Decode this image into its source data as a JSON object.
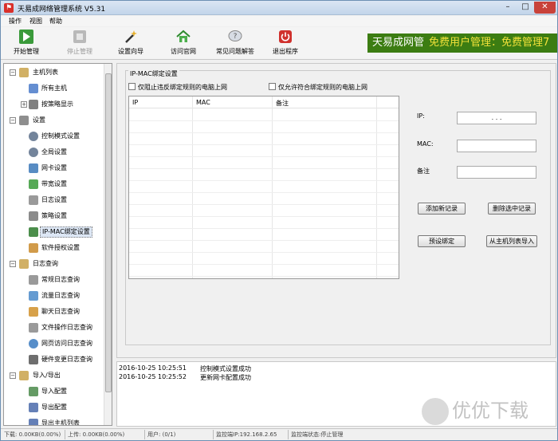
{
  "window": {
    "title": "天易成网络管理系统 V5.31",
    "minimize": "–",
    "maximize": "□",
    "close": "✕"
  },
  "menu": [
    "操作",
    "视图",
    "帮助"
  ],
  "toolbar": [
    {
      "label": "开始管理",
      "icon": "play-icon",
      "enabled": true
    },
    {
      "label": "停止管理",
      "icon": "stop-icon",
      "enabled": false
    },
    {
      "label": "设置向导",
      "icon": "wand-icon",
      "enabled": true
    },
    {
      "label": "访问官网",
      "icon": "home-icon",
      "enabled": true
    },
    {
      "label": "常见问题解答",
      "icon": "faq-icon",
      "enabled": true
    },
    {
      "label": "退出程序",
      "icon": "power-icon",
      "enabled": true
    }
  ],
  "banner": {
    "text": "天易成网管",
    "highlight": "免费用户管理：免费管理7"
  },
  "tree": [
    {
      "label": "主机列表",
      "expander": "−",
      "level": 0
    },
    {
      "label": "所有主机",
      "level": 1
    },
    {
      "label": "按策略显示",
      "expander": "+",
      "level": 1
    },
    {
      "label": "设置",
      "expander": "−",
      "level": 0
    },
    {
      "label": "控制模式设置",
      "level": 1
    },
    {
      "label": "全局设置",
      "level": 1
    },
    {
      "label": "网卡设置",
      "level": 1
    },
    {
      "label": "带宽设置",
      "level": 1
    },
    {
      "label": "日志设置",
      "level": 1
    },
    {
      "label": "策略设置",
      "level": 1
    },
    {
      "label": "IP-MAC绑定设置",
      "level": 1,
      "selected": true
    },
    {
      "label": "软件授权设置",
      "level": 1
    },
    {
      "label": "日志查询",
      "expander": "−",
      "level": 0
    },
    {
      "label": "常规日志查询",
      "level": 1
    },
    {
      "label": "流量日志查询",
      "level": 1
    },
    {
      "label": "聊天日志查询",
      "level": 1
    },
    {
      "label": "文件操作日志查询",
      "level": 1
    },
    {
      "label": "网页访问日志查询",
      "level": 1
    },
    {
      "label": "硬件变更日志查询",
      "level": 1
    },
    {
      "label": "导入/导出",
      "expander": "−",
      "level": 0
    },
    {
      "label": "导入配置",
      "level": 1
    },
    {
      "label": "导出配置",
      "level": 1
    },
    {
      "label": "导出主机列表",
      "level": 1
    }
  ],
  "panel": {
    "group_title": "IP-MAC绑定设置",
    "check1": "仅阻止违反绑定规则的电脑上网",
    "check2": "仅允许符合绑定规则的电脑上网",
    "columns": [
      "IP",
      "MAC",
      "备注"
    ],
    "ip_label": "IP:",
    "ip_value": ".      .      .",
    "mac_label": "MAC:",
    "mac_value": "",
    "note_label": "备注",
    "note_value": "",
    "btn_add": "添加新记录",
    "btn_delete": "删除选中记录",
    "btn_preset": "预设绑定",
    "btn_import": "从主机列表导入"
  },
  "log": [
    {
      "time": "2016-10-25 10:25:51",
      "msg": "控制模式设置成功"
    },
    {
      "time": "2016-10-25 10:25:52",
      "msg": "更新网卡配置成功"
    }
  ],
  "status": {
    "download": "下载: 0.00KB(0.00%)",
    "upload": "上传: 0.00KB(0.00%)",
    "users": "用户: (0/1)",
    "monitor_ip": "监控端IP:192.168.2.65",
    "monitor_state": "监控端状态:停止管理"
  },
  "watermark": "优优下载"
}
